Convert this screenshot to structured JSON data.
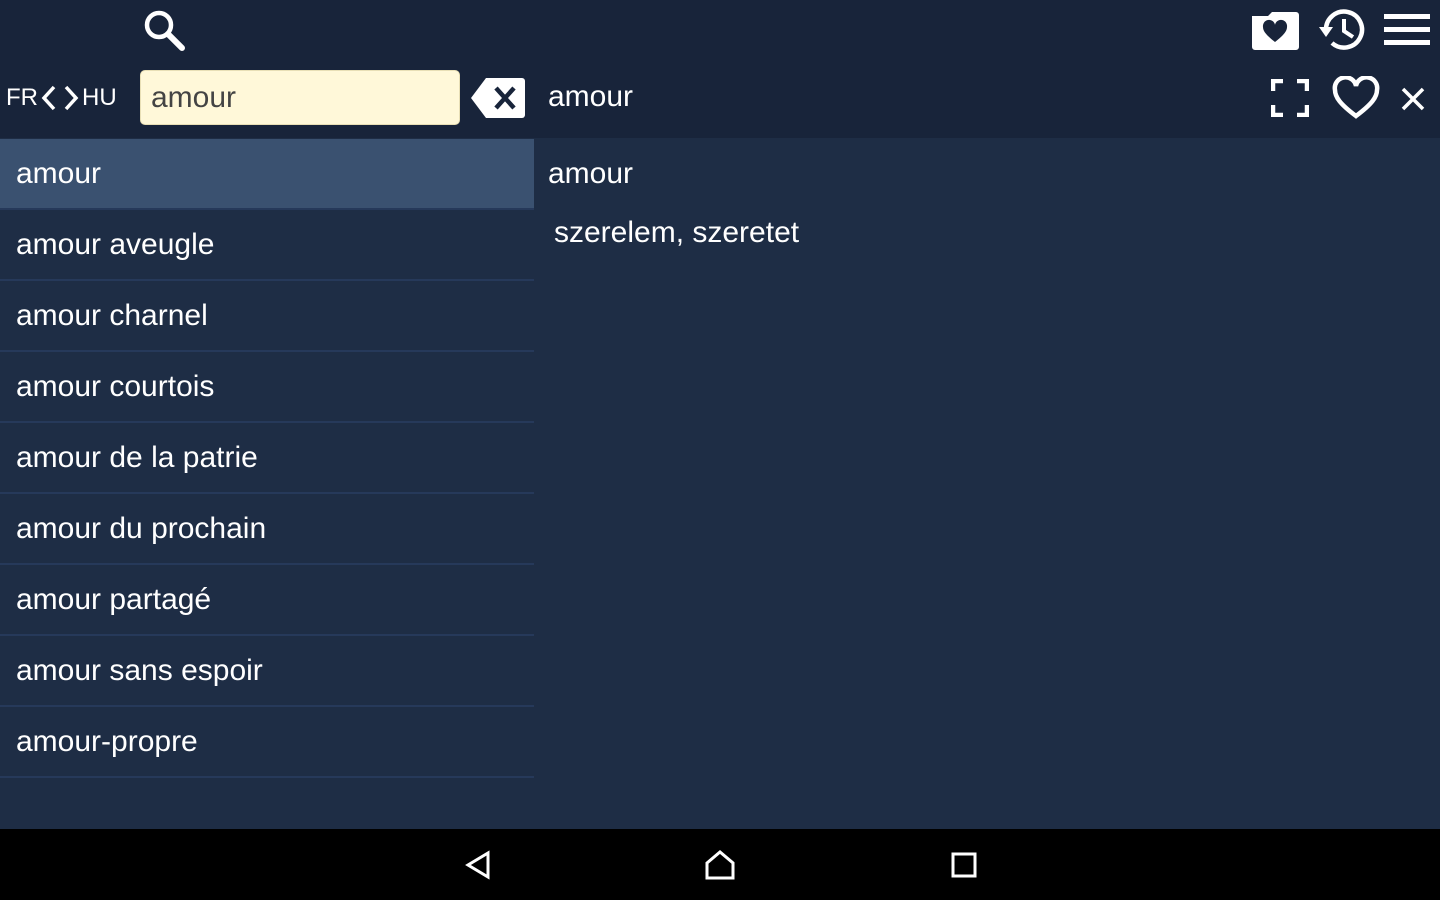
{
  "toolbar": {
    "icons": {
      "search": "search-icon",
      "favorites_folder": "heart-folder-icon",
      "history": "history-icon",
      "menu": "menu-icon"
    }
  },
  "search_bar": {
    "source_lang": "FR",
    "target_lang": "HU",
    "query": "amour",
    "clear_icon": "backspace-clear-icon"
  },
  "detail_header": {
    "word": "amour",
    "icons": {
      "fullscreen": "fullscreen-icon",
      "favorite": "heart-outline-icon",
      "close": "close-icon"
    }
  },
  "results": [
    {
      "label": "amour",
      "selected": true
    },
    {
      "label": "amour aveugle"
    },
    {
      "label": "amour charnel"
    },
    {
      "label": "amour courtois"
    },
    {
      "label": "amour de la patrie"
    },
    {
      "label": "amour du prochain"
    },
    {
      "label": "amour partagé"
    },
    {
      "label": "amour sans espoir"
    },
    {
      "label": "amour-propre"
    }
  ],
  "detail": {
    "headword": "amour",
    "translation": "szerelem, szeretet"
  },
  "navbar": {
    "icons": {
      "back": "back-icon",
      "home": "home-icon",
      "recents": "recents-icon"
    }
  },
  "colors": {
    "background": "#1e2d45",
    "topbar": "#18243a",
    "selected_row": "#3a5170",
    "search_field": "#fff8d9"
  }
}
